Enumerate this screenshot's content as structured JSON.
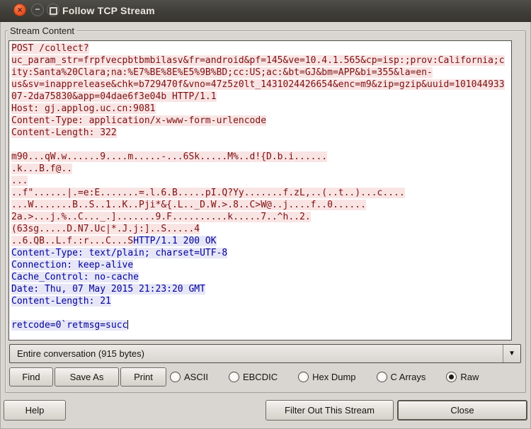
{
  "window": {
    "title": "Follow TCP Stream"
  },
  "titlebar": {
    "close_glyph": "×",
    "minimize_glyph": "−"
  },
  "groupbox_label": "Stream Content",
  "stream": {
    "colors": {
      "client_text": "#7c1010",
      "client_bg": "#f9e4e4",
      "server_text": "#00009b",
      "server_bg": "#e6e6f7"
    },
    "lines": [
      {
        "c": "client",
        "t": "POST /collect?"
      },
      {
        "c": "client",
        "t": "uc_param_str=frpfvecpbtbmbilasv&fr=android&pf=145&ve=10.4.1.565&cp=isp:;prov:California;c"
      },
      {
        "c": "client",
        "t": "ity:Santa%20Clara;na:%E7%BE%8E%E5%9B%BD;cc:US;ac:&bt=GJ&bm=APP&bi=355&la=en-"
      },
      {
        "c": "client",
        "t": "us&sv=inapprelease&chk=b729470f&vno=47z5z0lt_1431024426654&enc=m9&zip=gzip&uuid=101044933"
      },
      {
        "c": "client",
        "t": "07-2da75830&app=04dae6f3e04b HTTP/1.1"
      },
      {
        "c": "client",
        "t": "Host: gj.applog.uc.cn:9081"
      },
      {
        "c": "client",
        "t": "Content-Type: application/x-www-form-urlencode"
      },
      {
        "c": "client",
        "t": "Content-Length: 322"
      },
      {
        "c": "blank"
      },
      {
        "c": "client",
        "t": "m90...qW.w......9....m.....-...6Sk.....M%..d!{D.b.i......"
      },
      {
        "c": "client",
        "t": ".k...B.f@.."
      },
      {
        "c": "client",
        "t": "..."
      },
      {
        "c": "client",
        "t": "..f\"......|.=e:E.......=.l.6.B.....pI.Q?Yy.......f.zL,..(..t..)...c...."
      },
      {
        "c": "client",
        "t": "...W.......B..S..1..K..Pji*&{.L.._D.W.>.8..C>W@..j....f..0......"
      },
      {
        "c": "client",
        "t": "2a.>...j.%..C..._.].......9.F..........k.....7..^h..2."
      },
      {
        "c": "client",
        "t": "(63sg.....D.N7.Uc|*.J.j:]..S.....4"
      },
      {
        "c": "mixed",
        "segments": [
          {
            "c": "client",
            "t": "..6.QB..L.f.:r...C...S"
          },
          {
            "c": "server",
            "t": "HTTP/1.1 200 OK"
          }
        ]
      },
      {
        "c": "server",
        "t": "Content-Type: text/plain; charset=UTF-8"
      },
      {
        "c": "server",
        "t": "Connection: keep-alive"
      },
      {
        "c": "server",
        "t": "Cache_Control: no-cache"
      },
      {
        "c": "server",
        "t": "Date: Thu, 07 May 2015 21:23:20 GMT"
      },
      {
        "c": "server",
        "t": "Content-Length: 21"
      },
      {
        "c": "blank"
      },
      {
        "c": "server",
        "t": "retcode=0`retmsg=succ",
        "cursor": true
      }
    ]
  },
  "range_dropdown": {
    "value": "Entire conversation (915 bytes)",
    "arrow_glyph": "▼"
  },
  "toolbar": {
    "find": "Find",
    "save_as": "Save As",
    "print": "Print"
  },
  "display_modes": {
    "options": [
      {
        "label": "ASCII",
        "selected": false
      },
      {
        "label": "EBCDIC",
        "selected": false
      },
      {
        "label": "Hex Dump",
        "selected": false
      },
      {
        "label": "C Arrays",
        "selected": false
      },
      {
        "label": "Raw",
        "selected": true
      }
    ]
  },
  "footer": {
    "help": "Help",
    "filter_out": "Filter Out This Stream",
    "close": "Close"
  }
}
